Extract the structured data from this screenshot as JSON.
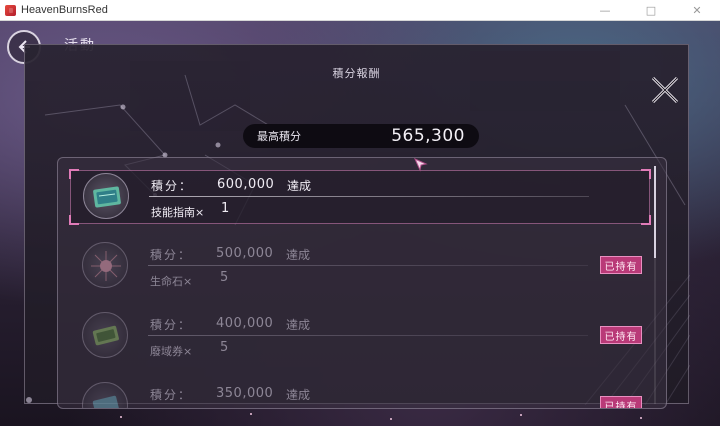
{
  "window": {
    "title": "HeavenBurnsRed",
    "controls": {
      "minimize": "—",
      "maximize": "□",
      "close": "✕"
    }
  },
  "screen": {
    "title": "活動",
    "back_icon": "back-arrow-icon"
  },
  "dialog": {
    "title": "積分報酬",
    "high_score_label": "最高積分",
    "high_score_value": "565,300",
    "close_icon": "close-x-icon"
  },
  "rewards": [
    {
      "score_label": "積分：",
      "score": "600,000",
      "status_text": "達成",
      "item_name": "技能指南×",
      "quantity": "1",
      "owned": false,
      "selected": true,
      "icon": "skill-guide-icon"
    },
    {
      "score_label": "積分：",
      "score": "500,000",
      "status_text": "達成",
      "item_name": "生命石×",
      "quantity": "5",
      "owned": true,
      "owned_label": "已持有",
      "icon": "life-stone-icon"
    },
    {
      "score_label": "積分：",
      "score": "400,000",
      "status_text": "達成",
      "item_name": "廢域券×",
      "quantity": "5",
      "owned": true,
      "owned_label": "已持有",
      "icon": "ticket-icon"
    },
    {
      "score_label": "積分：",
      "score": "350,000",
      "status_text": "達成",
      "owned": true,
      "owned_label": "已持有",
      "icon": "ticket-icon"
    }
  ],
  "colors": {
    "accent_pink": "#e07bb8",
    "owned_badge": "#b93a78",
    "text_primary": "#f0ecf4",
    "text_dim": "#8d8696"
  }
}
